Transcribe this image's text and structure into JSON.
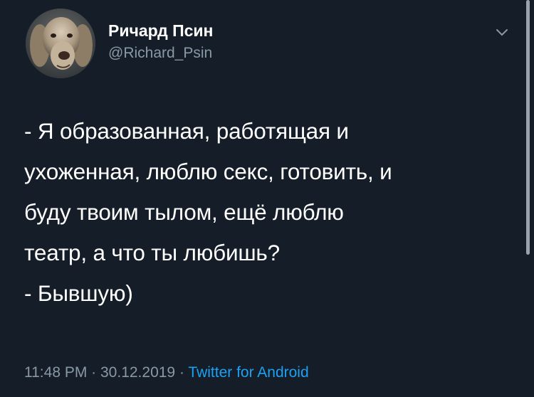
{
  "author": {
    "display_name": "Ричард Псин",
    "handle": "@Richard_Psin"
  },
  "tweet": {
    "lines": [
      "- Я образованная, работящая и",
      "ухоженная, люблю секс, готовить, и",
      "буду твоим тылом, ещё люблю",
      "театр, а что ты любишь?",
      "- Бывшую)"
    ]
  },
  "meta": {
    "time": "11:48 PM",
    "separator": " · ",
    "date": "30.12.2019",
    "source": "Twitter for Android"
  },
  "icons": {
    "avatar": "dog-avatar",
    "menu": "chevron-down-icon"
  },
  "colors": {
    "background": "#151d28",
    "secondary_text": "#8899a6",
    "link": "#1da1f2"
  }
}
